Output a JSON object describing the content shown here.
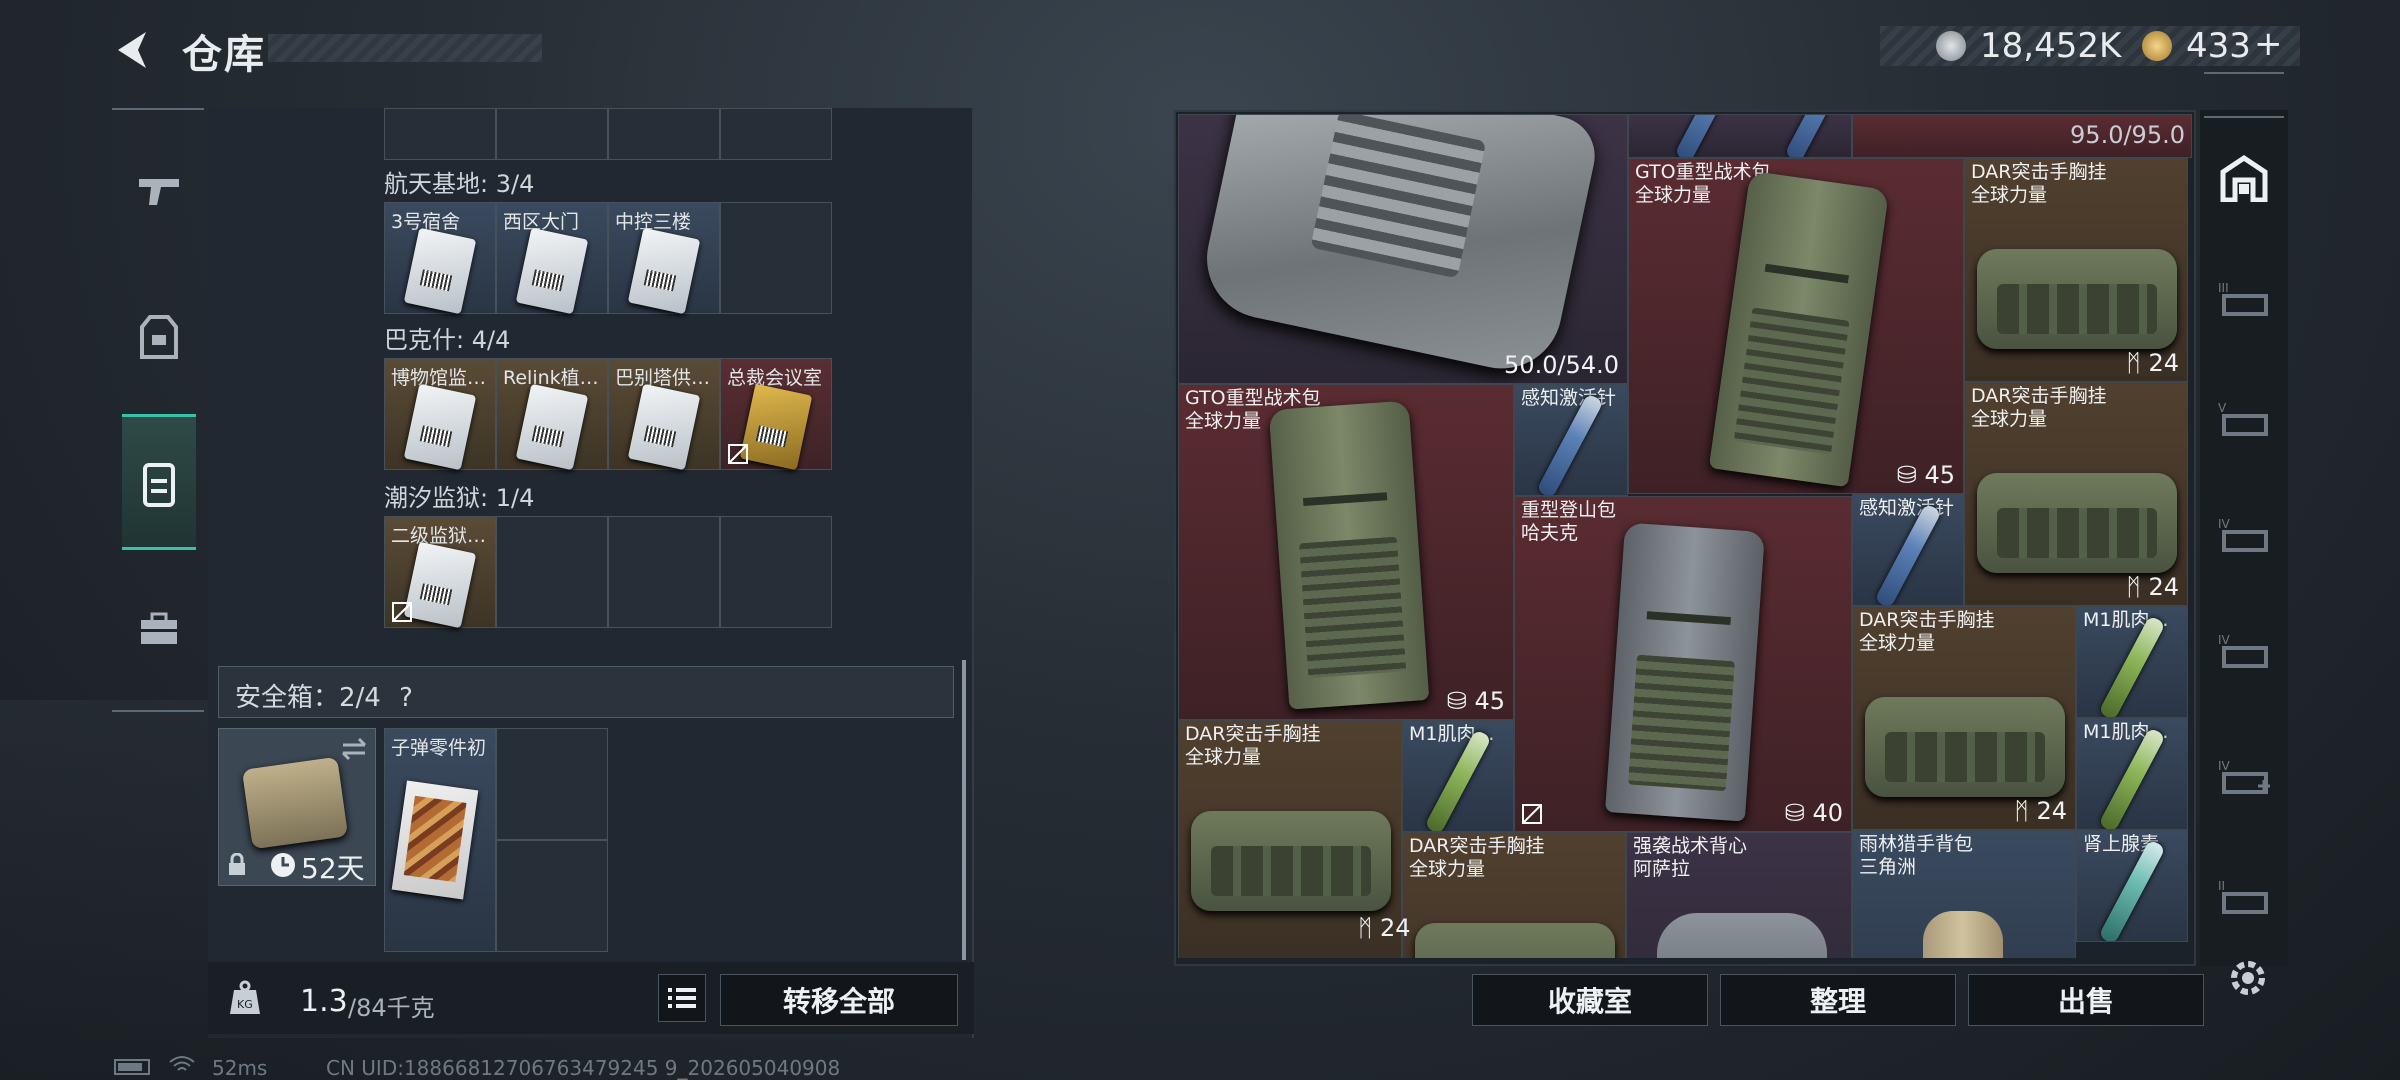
{
  "header": {
    "title": "仓库"
  },
  "currency": {
    "coin": "18,452K",
    "premium": "433",
    "plus": "+"
  },
  "left_groups": [
    {
      "label": "航天基地: 3/4",
      "slots": [
        "3号宿舍",
        "西区大门",
        "中控三楼"
      ]
    },
    {
      "label": "巴克什: 4/4",
      "slots": [
        "博物馆监…",
        "Relink植…",
        "巴别塔供…",
        "总裁会议室"
      ]
    },
    {
      "label": "潮汐监狱: 1/4",
      "slots": [
        "二级监狱…"
      ]
    }
  ],
  "safe_box": {
    "label": "安全箱：2/4",
    "help": "?",
    "days": "52天",
    "item": "子弹零件初"
  },
  "weight": {
    "current": "1.3",
    "max": "/84千克"
  },
  "buttons": {
    "transfer_all": "转移全部",
    "collection": "收藏室",
    "organize": "整理",
    "sell": "出售"
  },
  "stash": {
    "vest_durability": "50.0/54.0",
    "top_durability": "95.0/95.0",
    "items": [
      {
        "name": "GTO重型战术包",
        "sub": "全球力量",
        "count": "45"
      },
      {
        "name": "DAR突击手胸挂",
        "sub": "全球力量",
        "count": "24"
      },
      {
        "name": "GTO重型战术包",
        "sub": "全球力量",
        "count": "45"
      },
      {
        "name": "感知激活针"
      },
      {
        "name": "DAR突击手胸挂",
        "sub": "全球力量",
        "count": "24"
      },
      {
        "name": "重型登山包",
        "sub": "哈夫克",
        "count": "40"
      },
      {
        "name": "感知激活针"
      },
      {
        "name": "DAR突击手胸挂",
        "sub": "全球力量",
        "count": "24"
      },
      {
        "name": "M1肌肉…"
      },
      {
        "name": "DAR突击手胸挂",
        "sub": "全球力量"
      },
      {
        "name": "M1肌肉…"
      },
      {
        "name": "M1肌肉…"
      },
      {
        "name": "DAR突击手胸挂",
        "sub": "全球力量",
        "count": "24"
      },
      {
        "name": "强袭战术背心",
        "sub": "阿萨拉"
      },
      {
        "name": "雨林猎手背包",
        "sub": "三角洲"
      },
      {
        "name": "肾上腺素"
      }
    ]
  },
  "status": {
    "ping": "52ms",
    "uid": "CN UID:18866812706763479245 9_202605040908"
  },
  "colors": {
    "accent": "#39c3a6",
    "red_rarity": "#5a2c32",
    "gold_rarity": "#51402f",
    "blue_rarity": "#3a4a5f"
  }
}
